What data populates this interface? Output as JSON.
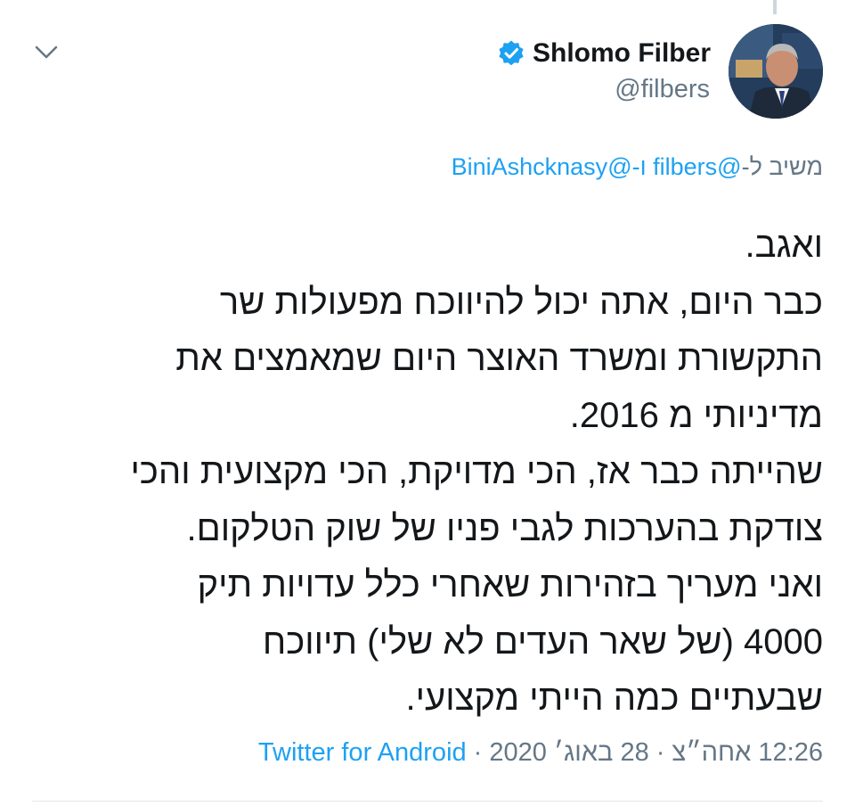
{
  "author": {
    "display_name": "Shlomo Filber",
    "handle": "@filbers",
    "verified": true,
    "avatar_icon": "profile-photo"
  },
  "reply": {
    "prefix": "משיב ל-",
    "mention_1": "@filbers",
    "joiner": " ו-",
    "mention_2": "@BiniAshcknasy"
  },
  "tweet": {
    "lines": [
      "ואגב.",
      "כבר היום, אתה יכול להיווכח מפעולות שר",
      "התקשורת ומשרד האוצר היום שמאמצים את",
      "מדיניותי מ 2016.",
      "שהייתה כבר אז, הכי מדויקת, הכי מקצועית והכי",
      "צודקת בהערכות לגבי פניו של שוק הטלקום.",
      "ואני מעריך בזהירות שאחרי כלל עדויות תיק",
      "4000 (של שאר העדים לא שלי) תיווכח",
      "שבעתיים כמה הייתי מקצועי."
    ]
  },
  "meta": {
    "time": "12:26",
    "period": "אחה״צ",
    "separator": "·",
    "date": "28 באוג׳ 2020",
    "source": "Twitter for Android"
  },
  "colors": {
    "link": "#1da1f2",
    "secondary_text": "#657786",
    "primary_text": "#14171a",
    "verified_badge": "#1da1f2"
  },
  "icons": {
    "menu": "chevron-down-icon",
    "verified": "verified-badge-icon"
  }
}
